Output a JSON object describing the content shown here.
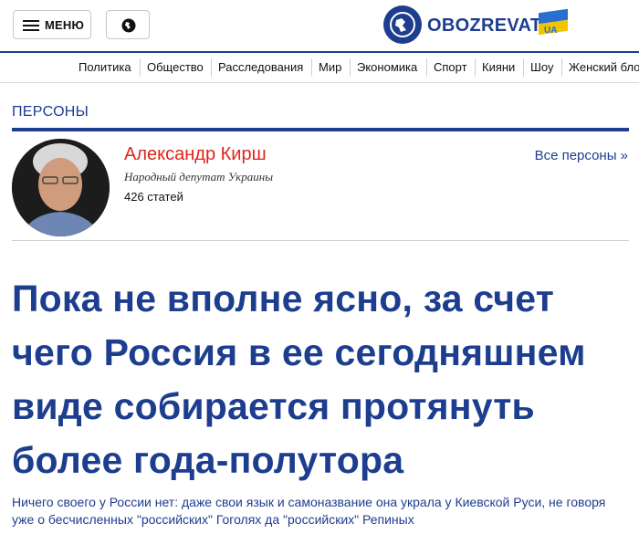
{
  "header": {
    "menu_label": "МЕНЮ",
    "menu_icon": "hamburger-icon",
    "globe_icon": "globe-icon",
    "logo_text": "OBOZREVATEL",
    "logo_suffix": "UA"
  },
  "nav": {
    "items": [
      "Политика",
      "Общество",
      "Расследования",
      "Мир",
      "Экономика",
      "Спорт",
      "Кияни",
      "Шоу",
      "Женский блог"
    ]
  },
  "section": {
    "title": "ПЕРСОНЫ"
  },
  "person": {
    "name": "Александр Кирш",
    "role": "Народный депутат Украины",
    "articles": "426 статей",
    "all_link": "Все персоны »"
  },
  "article": {
    "headline": "Пока не вполне ясно, за счет чего Россия в ее сегодняшнем виде собирается протянуть более года-полутора",
    "lead": "Ничего своего у России нет: даже свои язык и самоназвание она украла у Киевской Руси, не говоря уже о бесчисленных \"российских\" Гоголях да \"российских\" Репиных"
  },
  "colors": {
    "brand_blue": "#1d3d8f",
    "name_red": "#e0241b",
    "flag_blue": "#2a6fd0",
    "flag_yellow": "#f2c400"
  }
}
